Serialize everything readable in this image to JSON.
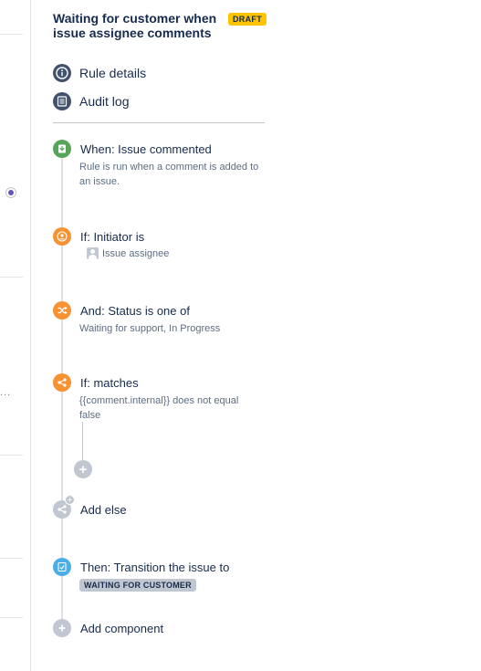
{
  "header": {
    "title": "Waiting for customer when issue assignee comments",
    "badge": "DRAFT"
  },
  "nav": {
    "rule_details": "Rule details",
    "audit_log": "Audit log"
  },
  "steps": [
    {
      "title": "When: Issue commented",
      "description": "Rule is run when a comment is added to an issue.",
      "icon": "trigger-icon",
      "color": "#57a55a"
    },
    {
      "title": "If: Initiator is",
      "value": "Issue assignee",
      "icon": "user-icon",
      "color": "#f79232"
    },
    {
      "title": "And: Status is one of",
      "description": "Waiting for support, In Progress",
      "icon": "shuffle-icon",
      "color": "#f79232"
    },
    {
      "title": "If: matches",
      "description": "{{comment.internal}} does not equal false",
      "icon": "branch-icon",
      "color": "#f79232"
    },
    {
      "title": "Add else",
      "icon": "add-else-icon",
      "color": "#c1c7d0"
    },
    {
      "title": "Then: Transition the issue to",
      "value": "WAITING FOR CUSTOMER",
      "icon": "transition-icon",
      "color": "#4bade8"
    },
    {
      "title": "Add component",
      "icon": "plus-icon",
      "color": "#c1c7d0"
    }
  ],
  "left_panel": {
    "ellipsis": "..."
  }
}
